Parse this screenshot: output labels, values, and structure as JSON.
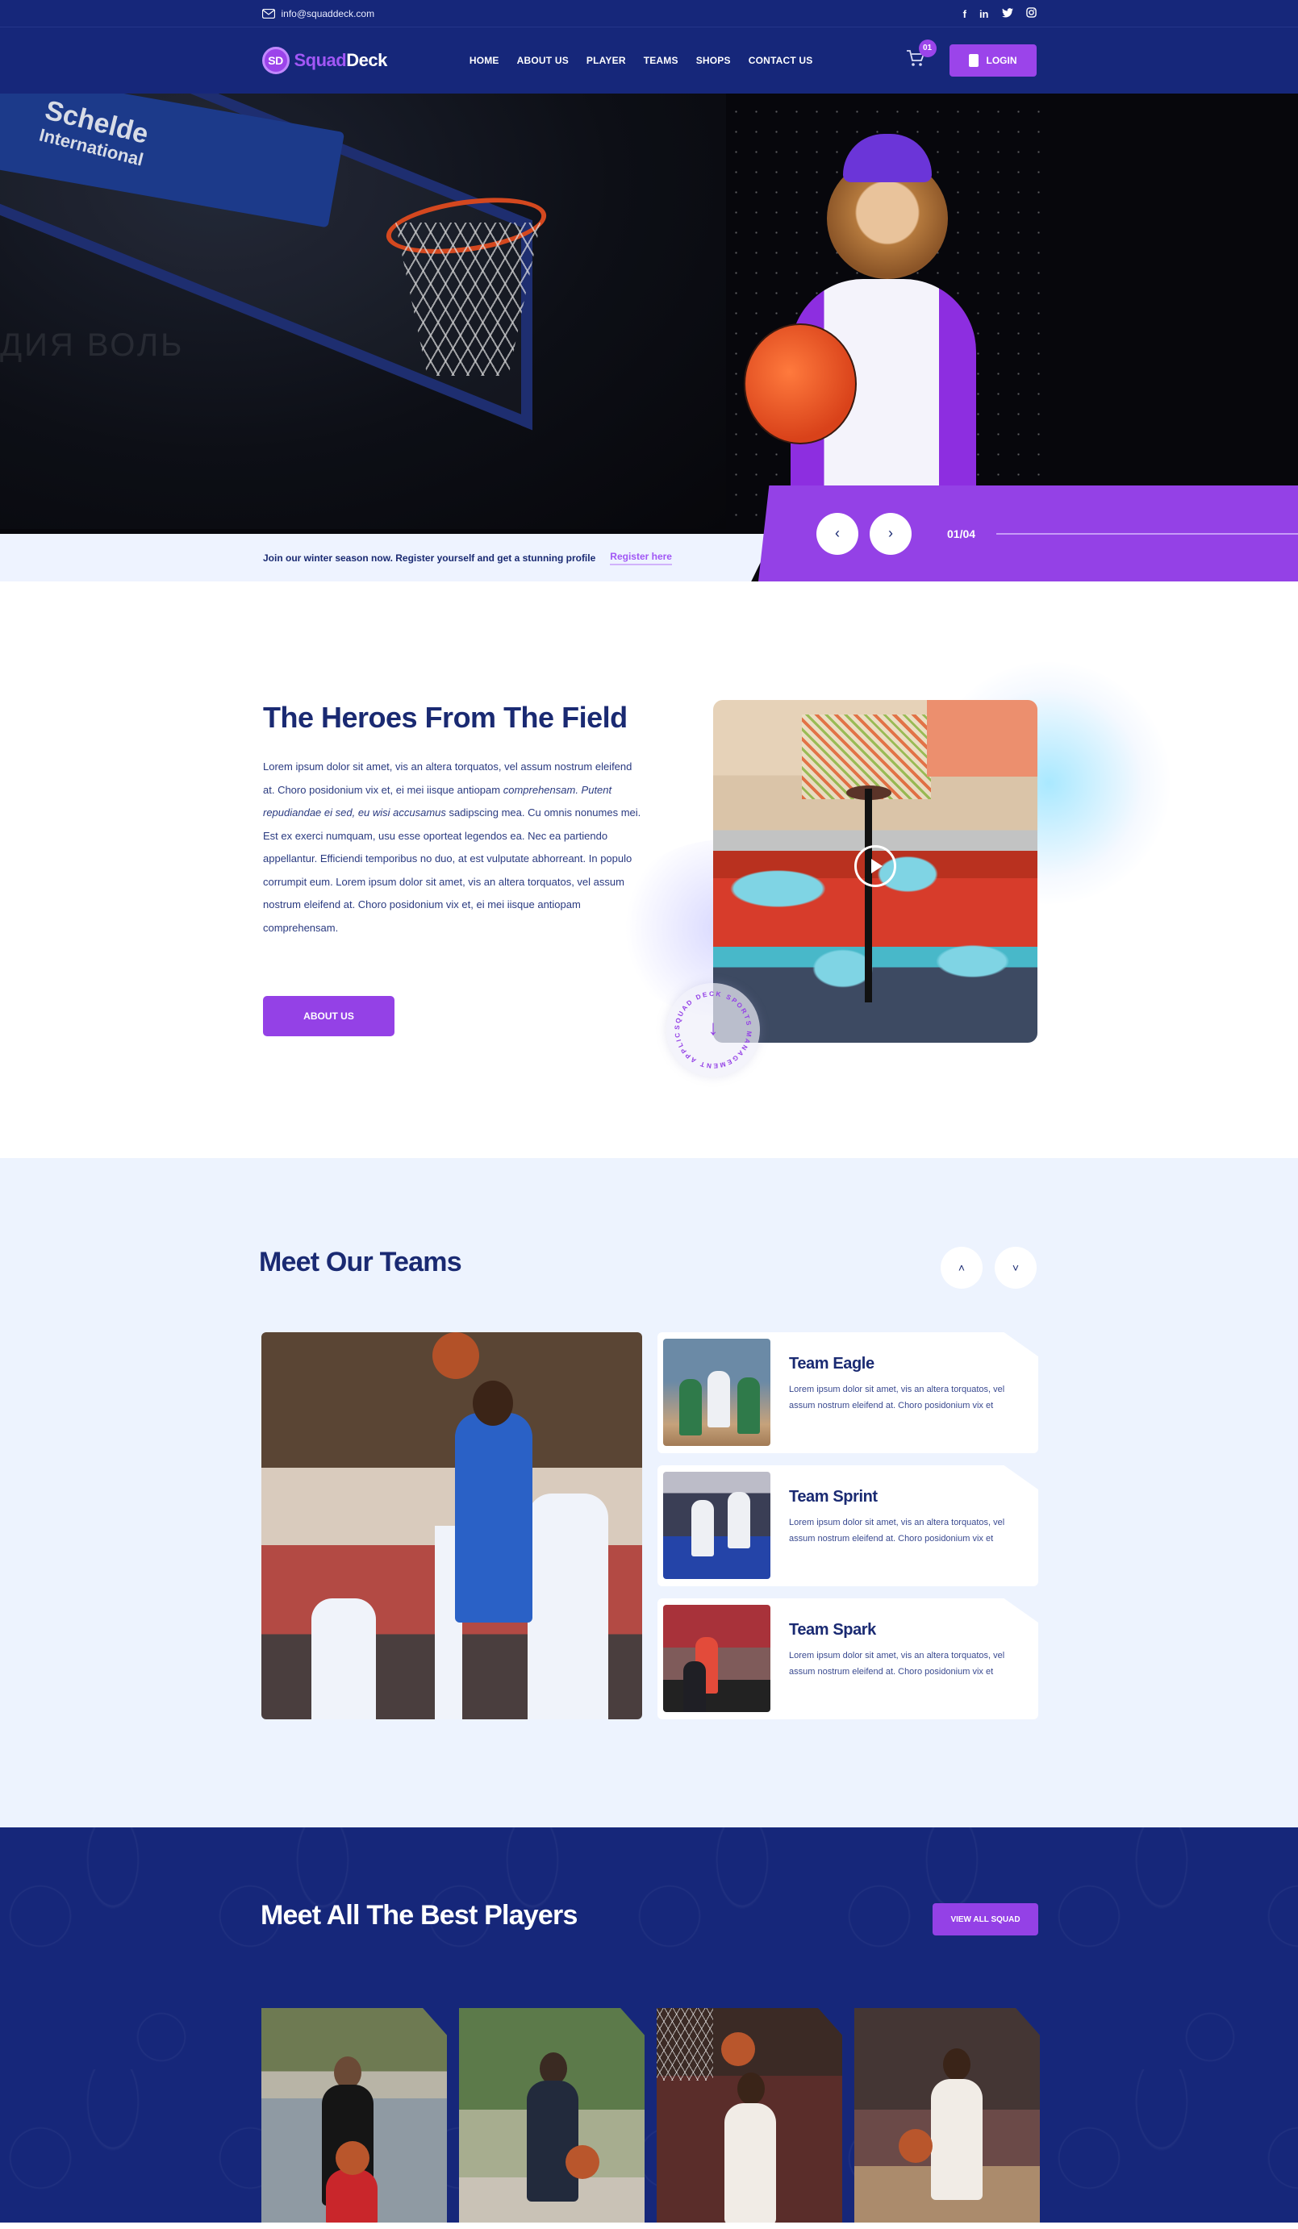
{
  "colors": {
    "navy": "#16277a",
    "purple": "#9441e6",
    "light_bg": "#edf3fe",
    "heading": "#1a2a72"
  },
  "topbar": {
    "email": "info@squaddeck.com",
    "email_icon": "mail-icon",
    "social": [
      {
        "name": "facebook",
        "glyph": "f"
      },
      {
        "name": "linkedin",
        "glyph": "in"
      },
      {
        "name": "twitter",
        "glyph": "🐦"
      },
      {
        "name": "instagram",
        "glyph": "◎"
      }
    ]
  },
  "header": {
    "logo_mark": "SD",
    "logo_part1": "Squad",
    "logo_part2": "Deck",
    "nav": [
      "HOME",
      "ABOUT US",
      "PLAYER",
      "TEAMS",
      "SHOPS",
      "CONTACT US"
    ],
    "cart_count": "01",
    "login_label": "LOGIN"
  },
  "hero": {
    "backboard_brand": "Schelde",
    "backboard_sub": "International",
    "background_text": "ДИЯ ВОЛЬ",
    "promo_text": "Join our winter season now. Register yourself and get a stunning profile",
    "promo_link": "Register here",
    "prev_label": "‹",
    "next_label": "›",
    "slide_counter": "01/04",
    "slide_progress": "1 of 4"
  },
  "about": {
    "title": "The Heroes From The Field",
    "body_1": "Lorem ipsum dolor sit amet, vis an altera torquatos, vel assum nostrum eleifend at. Choro posidonium vix et, ei mei iisque antiopam ",
    "body_italic": "comprehensam. Putent repudiandae ei sed, eu wisi accusamus",
    "body_2": " sadipscing mea. Cu omnis nonumes mei. Est ex exerci numquam, usu esse oporteat legendos ea. Nec ea partiendo appellantur. Efficiendi temporibus no duo, at est vulputate abhorreant. In populo corrumpit eum. Lorem ipsum dolor sit amet, vis an altera torquatos, vel assum nostrum eleifend at. Choro posidonium vix et, ei mei iisque antiopam comprehensam.",
    "button": "ABOUT US",
    "circle_text": "SQUAD DECK SPORTS MANAGEMENT APPLICATION ",
    "scroll_arrow": "↓"
  },
  "teams": {
    "title": "Meet Our Teams",
    "up_label": "˄",
    "down_label": "˅",
    "items": [
      {
        "name": "Team Eagle",
        "desc": "Lorem ipsum dolor sit amet, vis an altera torquatos, vel assum nostrum eleifend at. Choro posidonium vix et"
      },
      {
        "name": "Team Sprint",
        "desc": "Lorem ipsum dolor sit amet, vis an altera torquatos, vel assum nostrum eleifend at. Choro posidonium vix et"
      },
      {
        "name": "Team Spark",
        "desc": "Lorem ipsum dolor sit amet, vis an altera torquatos, vel assum nostrum eleifend at. Choro posidonium vix et"
      }
    ]
  },
  "players": {
    "title": "Meet All The Best Players",
    "button": "VIEW ALL SQUAD"
  }
}
